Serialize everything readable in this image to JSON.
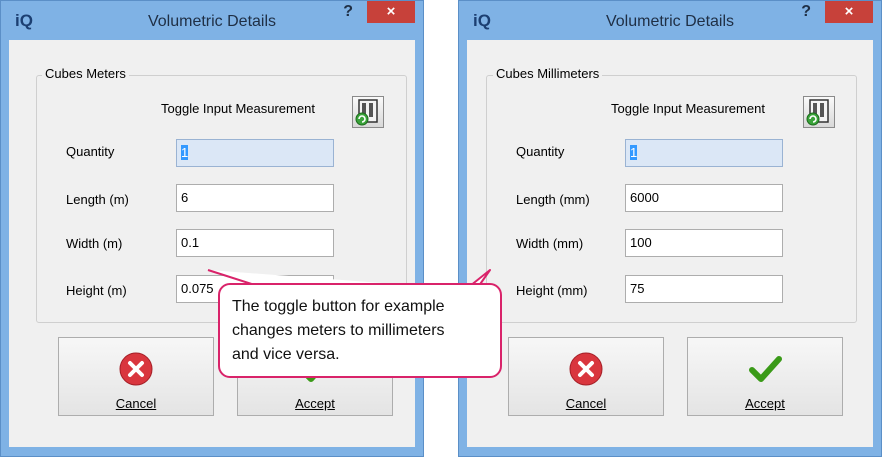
{
  "dialogs": [
    {
      "logo": "iQ",
      "title": "Volumetric Details",
      "help_label": "?",
      "close_label": "×",
      "group_label": "Cubes Meters",
      "toggle_label": "Toggle Input Measurement",
      "fields": [
        {
          "label": "Quantity",
          "value": "1"
        },
        {
          "label": "Length (m)",
          "value": "6"
        },
        {
          "label": "Width (m)",
          "value": "0.1"
        },
        {
          "label": "Height (m)",
          "value": "0.075"
        }
      ],
      "cancel_label": "Cancel",
      "accept_label": "Accept"
    },
    {
      "logo": "iQ",
      "title": "Volumetric Details",
      "help_label": "?",
      "close_label": "×",
      "group_label": "Cubes Millimeters",
      "toggle_label": "Toggle Input Measurement",
      "fields": [
        {
          "label": "Quantity",
          "value": "1"
        },
        {
          "label": "Length (mm)",
          "value": "6000"
        },
        {
          "label": "Width (mm)",
          "value": "100"
        },
        {
          "label": "Height (mm)",
          "value": "75"
        }
      ],
      "cancel_label": "Cancel",
      "accept_label": "Accept"
    }
  ],
  "callout": {
    "lines": [
      "The toggle button for example",
      "changes meters to millimeters",
      "and vice versa."
    ]
  },
  "colors": {
    "frame": "#7fb2e5",
    "close": "#c7413a",
    "callout_border": "#d9236a",
    "cancel_icon": "#d9363e",
    "accept_icon": "#3a9a18"
  },
  "icons": [
    "close-icon",
    "help-icon",
    "toggle-measurement-icon",
    "cancel-icon",
    "checkmark-icon"
  ]
}
